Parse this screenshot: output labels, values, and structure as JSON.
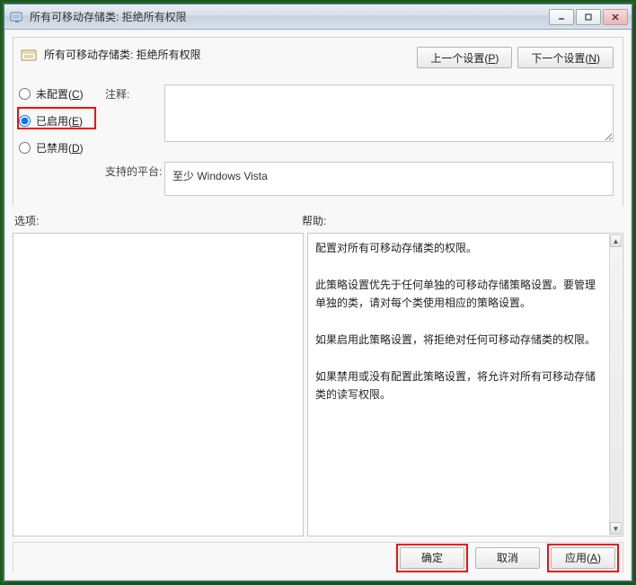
{
  "window": {
    "title": "所有可移动存储类: 拒绝所有权限"
  },
  "header": {
    "policy_title": "所有可移动存储类: 拒绝所有权限",
    "prev_setting_label": "上一个设置(P)",
    "next_setting_label": "下一个设置(N)"
  },
  "radios": {
    "not_configured": "未配置(C)",
    "enabled": "已启用(E)",
    "disabled": "已禁用(D)"
  },
  "comment": {
    "label": "注释:",
    "value": ""
  },
  "platform": {
    "label": "支持的平台:",
    "value": "至少 Windows Vista"
  },
  "labels": {
    "options": "选项:",
    "help": "帮助:"
  },
  "help_text": "配置对所有可移动存储类的权限。\n\n此策略设置优先于任何单独的可移动存储策略设置。要管理单独的类，请对每个类使用相应的策略设置。\n\n如果启用此策略设置，将拒绝对任何可移动存储类的权限。\n\n如果禁用或没有配置此策略设置，将允许对所有可移动存储类的读写权限。",
  "footer": {
    "ok": "确定",
    "cancel": "取消",
    "apply": "应用(A)"
  }
}
